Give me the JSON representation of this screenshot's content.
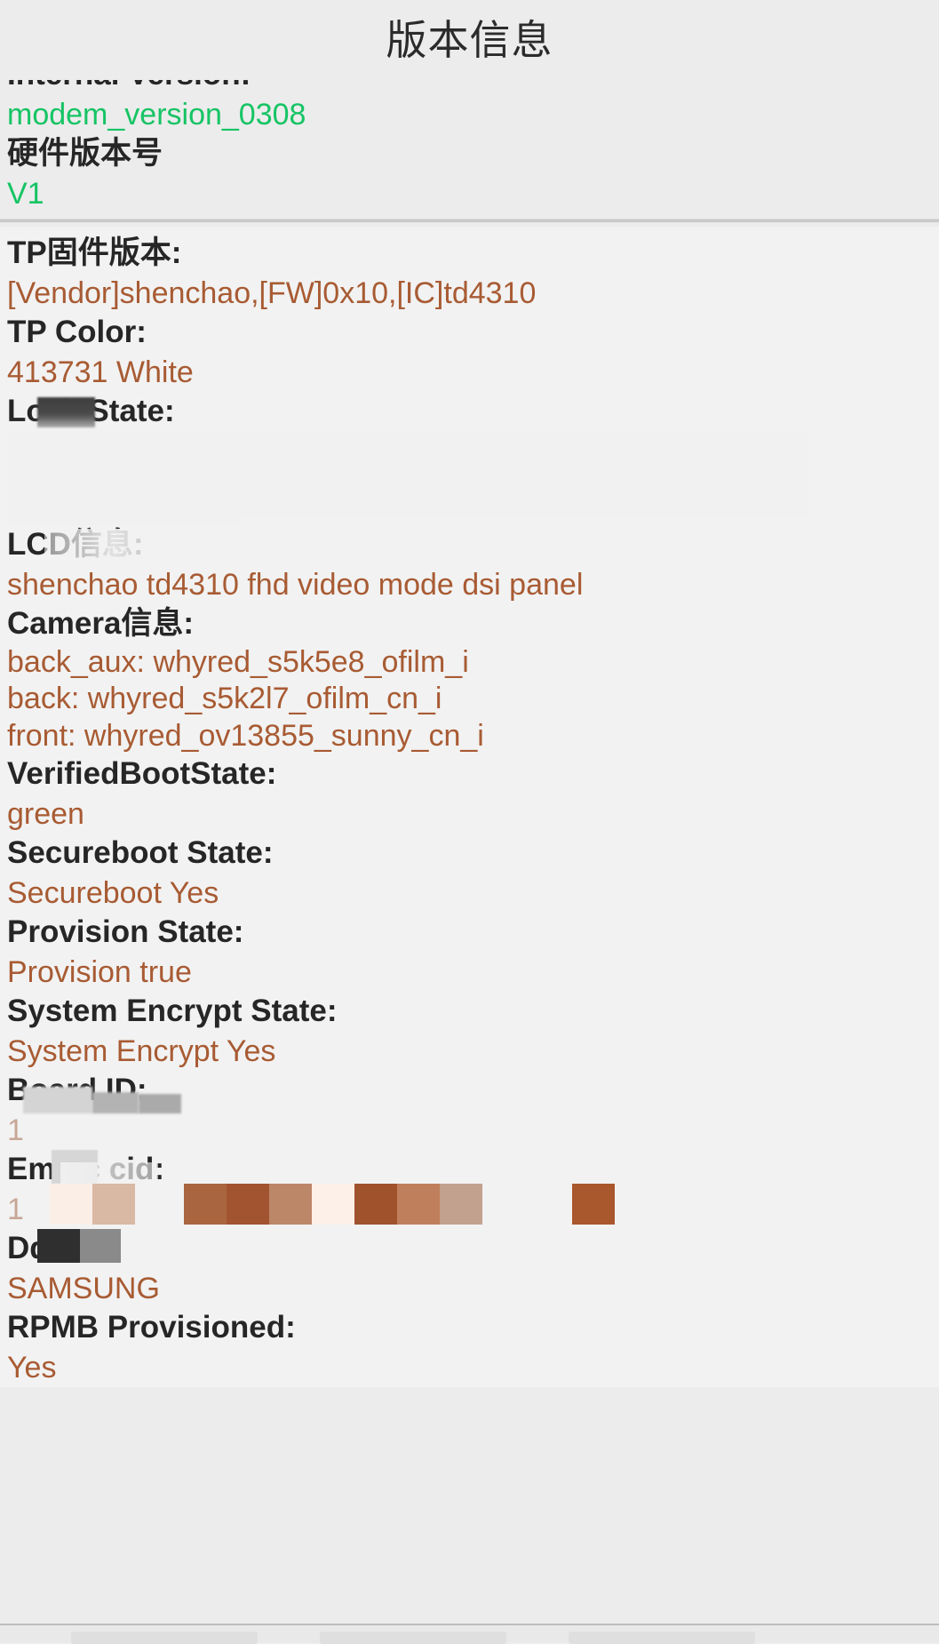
{
  "header": {
    "title": "版本信息"
  },
  "sections": [
    {
      "id": "top",
      "rows": [
        {
          "key": "Internal Version:",
          "value": "modem_version_0308",
          "value_style": "green",
          "clipped": true
        },
        {
          "key": "硬件版本号",
          "value": "V1",
          "value_style": "green"
        }
      ]
    },
    {
      "id": "bottom",
      "rows": [
        {
          "key": "TP固件版本:",
          "value": "[Vendor]shenchao,[FW]0x10,[IC]td4310"
        },
        {
          "key": "TP Color:",
          "value": "413731 White"
        },
        {
          "key": "Lock State:",
          "value": "",
          "redacted": "key-and-value"
        },
        {
          "key": "LCD信息:",
          "value": "shenchao td4310 fhd video mode dsi panel",
          "redacted": "key-partial"
        },
        {
          "key": "Camera信息:",
          "value_lines": [
            "back_aux: whyred_s5k5e8_ofilm_i",
            "back: whyred_s5k2l7_ofilm_cn_i",
            "front: whyred_ov13855_sunny_cn_i"
          ]
        },
        {
          "key": "VerifiedBootState:",
          "value": "green"
        },
        {
          "key": "Secureboot State:",
          "value": "Secureboot Yes"
        },
        {
          "key": "Provision State:",
          "value": "Provision true"
        },
        {
          "key": "System Encrypt State:",
          "value": "System Encrypt  Yes"
        },
        {
          "key": "Board ID:",
          "value": "1",
          "value_style": "faded",
          "redacted": "key-partial"
        },
        {
          "key": "Emmc cid:",
          "value": "1",
          "value_style": "faded",
          "redacted": "key-partial-and-value-blocks"
        },
        {
          "key": "Ddr:",
          "value": "SAMSUNG",
          "redacted": "key-partial"
        },
        {
          "key": "RPMB Provisioned:",
          "value": "Yes"
        }
      ]
    }
  ],
  "redaction": {
    "note": "obscured",
    "block_colors": [
      "#fbeee6",
      "#d9b8a4",
      "#a9653f",
      "#a25430",
      "#bc8669",
      "#fcf0e8",
      "#a0522d",
      "#c07f5c",
      "#c2a18f",
      "#a9572c"
    ],
    "gray_colors": [
      "#2f2f2f",
      "#8a8a8a",
      "#d4d4d4",
      "#b3b3b3"
    ]
  },
  "colors": {
    "background": "#ececec",
    "panel": "#f2f2f2",
    "key_text": "#262626",
    "value_text": "#a85b33",
    "accent_green": "#16c464",
    "divider": "#c9c9c9"
  }
}
